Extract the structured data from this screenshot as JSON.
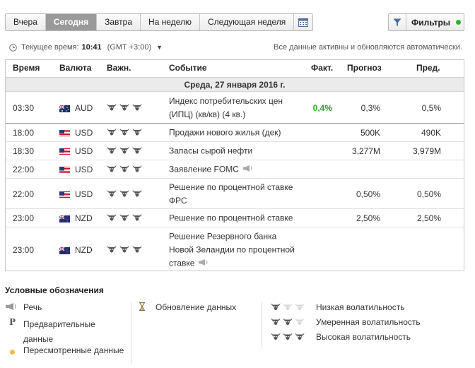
{
  "nav": {
    "tabs": [
      "Вчера",
      "Сегодня",
      "Завтра",
      "На неделю",
      "Следующая неделя"
    ],
    "active": "Сегодня",
    "filters_label": "Фильтры",
    "filter_status_color": "#2cb32c"
  },
  "time": {
    "label": "Текущее время:",
    "value": "10:41",
    "tz": "(GMT +3:00)",
    "info": "Все данные активны и обновляются автоматически."
  },
  "table": {
    "headers": {
      "time": "Время",
      "currency": "Валюта",
      "importance": "Важн.",
      "event": "Событие",
      "actual": "Факт.",
      "forecast": "Прогноз",
      "previous": "Пред."
    },
    "date_row": "Среда, 27 января 2016 г.",
    "rows": [
      {
        "time": "03:30",
        "flag": "au-flag-icon",
        "currency": "AUD",
        "importance": 3,
        "event": "Индекс потребительских цен (ИПЦ) (кв/кв) (4 кв.)",
        "actual": "0,4%",
        "actual_color": "#2ca02c",
        "forecast": "0,3%",
        "previous": "0,5%"
      },
      {
        "time": "18:00",
        "flag": "us-flag-icon",
        "currency": "USD",
        "importance": 3,
        "event": "Продажи нового жилья (дек)",
        "actual": "",
        "forecast": "500K",
        "previous": "490K"
      },
      {
        "time": "18:30",
        "flag": "us-flag-icon",
        "currency": "USD",
        "importance": 3,
        "event": "Запасы сырой нефти",
        "actual": "",
        "forecast": "3,277M",
        "previous": "3,979M"
      },
      {
        "time": "22:00",
        "flag": "us-flag-icon",
        "currency": "USD",
        "importance": 3,
        "event": "Заявление FOMC",
        "speech": true,
        "actual": "",
        "forecast": "",
        "previous": ""
      },
      {
        "time": "22:00",
        "flag": "us-flag-icon",
        "currency": "USD",
        "importance": 3,
        "event": "Решение по процентной ставке ФРС",
        "actual": "",
        "forecast": "0,50%",
        "previous": "0,50%"
      },
      {
        "time": "23:00",
        "flag": "nz-flag-icon",
        "currency": "NZD",
        "importance": 3,
        "event": "Решение по процентной ставке",
        "actual": "",
        "forecast": "2,50%",
        "previous": "2,50%"
      },
      {
        "time": "23:00",
        "flag": "nz-flag-icon",
        "currency": "NZD",
        "importance": 3,
        "event": "Решение Резервного банка Новой Зеландии по процентной ставке",
        "speech": true,
        "actual": "",
        "forecast": "",
        "previous": ""
      }
    ]
  },
  "legend": {
    "title": "Условные обозначения",
    "speech": "Речь",
    "preliminary_icon_letter": "P",
    "preliminary": "Предварительные данные",
    "revised": "Пересмотренные данные",
    "update": "Обновление данных",
    "low": "Низкая волатильность",
    "moderate": "Умеренная волатильность",
    "high": "Высокая волатильность"
  }
}
